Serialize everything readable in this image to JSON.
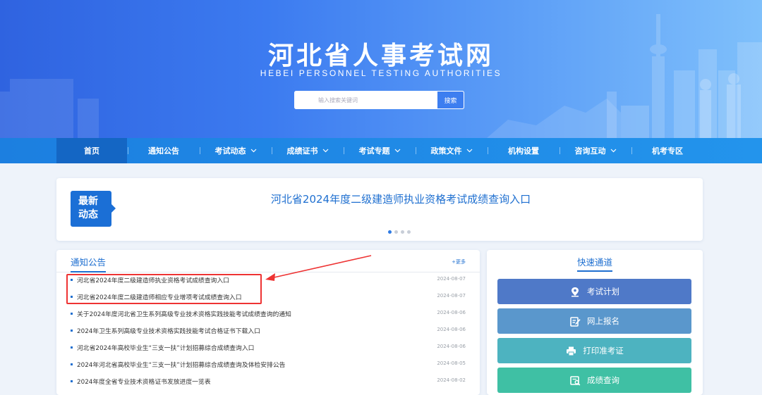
{
  "header": {
    "title": "河北省人事考试网",
    "subtitle": "HEBEI PERSONNEL TESTING AUTHORITIES",
    "search": {
      "placeholder": "输入搜索关键词",
      "button_label": "搜索"
    }
  },
  "nav": {
    "items": [
      {
        "label": "首页",
        "has_dropdown": false,
        "active": true
      },
      {
        "label": "通知公告",
        "has_dropdown": false,
        "active": false
      },
      {
        "label": "考试动态",
        "has_dropdown": true,
        "active": false
      },
      {
        "label": "成绩证书",
        "has_dropdown": true,
        "active": false
      },
      {
        "label": "考试专题",
        "has_dropdown": true,
        "active": false
      },
      {
        "label": "政策文件",
        "has_dropdown": true,
        "active": false
      },
      {
        "label": "机构设置",
        "has_dropdown": false,
        "active": false
      },
      {
        "label": "咨询互动",
        "has_dropdown": true,
        "active": false
      },
      {
        "label": "机考专区",
        "has_dropdown": false,
        "active": false
      }
    ],
    "dropdown_icon": "chevron-down-icon"
  },
  "news": {
    "badge_line1": "最新",
    "badge_line2": "动态",
    "headline": "河北省2024年度二级建造师执业资格考试成绩查询入口",
    "carousel_pages": 4,
    "carousel_active_index": 0
  },
  "notices": {
    "title": "通知公告",
    "more_label": "+更多",
    "items": [
      {
        "text": "河北省2024年度二级建造师执业资格考试成绩查询入口",
        "date": "2024-08-07"
      },
      {
        "text": "河北省2024年度二级建造师相应专业增项考试成绩查询入口",
        "date": "2024-08-07"
      },
      {
        "text": "关于2024年度河北省卫生系列高级专业技术资格实践技能考试成绩查询的通知",
        "date": "2024-08-06"
      },
      {
        "text": "2024年卫生系列高级专业技术资格实践技能考试合格证书下载入口",
        "date": "2024-08-06"
      },
      {
        "text": "河北省2024年高校毕业生“三支一扶”计划招募综合成绩查询入口",
        "date": "2024-08-06"
      },
      {
        "text": "2024年河北省高校毕业生“三支一扶”计划招募综合成绩查询及体检安排公告",
        "date": "2024-08-05"
      },
      {
        "text": "2024年度全省专业技术资格证书发放进度一览表",
        "date": "2024-08-02"
      }
    ]
  },
  "quick": {
    "title": "快速通道",
    "buttons": [
      {
        "label": "考试计划",
        "icon": "location-pin-icon",
        "color": "#4f79c8"
      },
      {
        "label": "网上报名",
        "icon": "edit-form-icon",
        "color": "#5a97cc"
      },
      {
        "label": "打印准考证",
        "icon": "printer-icon",
        "color": "#4db3c0"
      },
      {
        "label": "成绩查询",
        "icon": "score-search-icon",
        "color": "#3fc0a4"
      }
    ]
  },
  "colors": {
    "accent": "#1e6fd0",
    "nav_bg": "#1c7fe0",
    "nav_active": "#1466c4",
    "highlight": "#e33333"
  }
}
